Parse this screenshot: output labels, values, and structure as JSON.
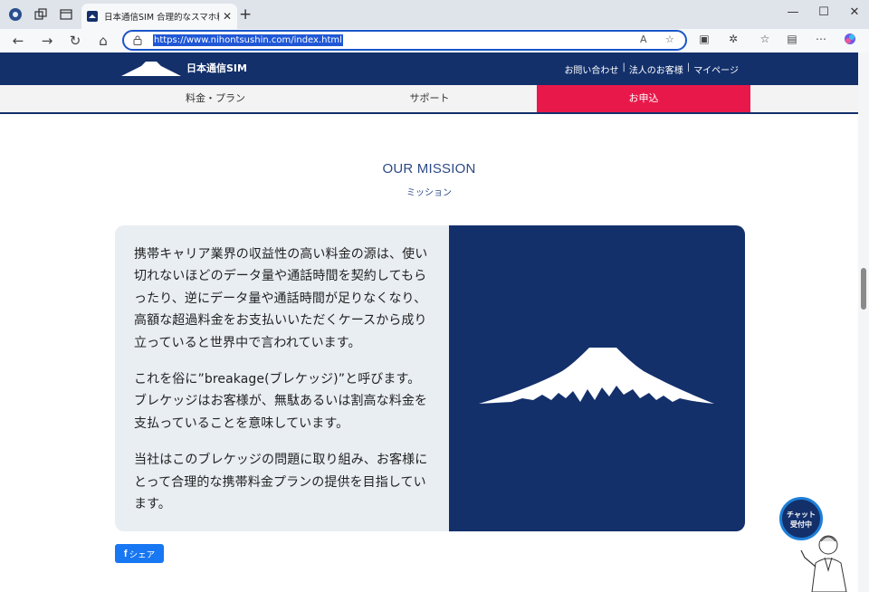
{
  "browser": {
    "tab_title": "日本通信SIM 合理的なスマホ料金",
    "url": "https://www.nihontsushin.com/index.html",
    "icons": [
      "browser-logo-icon",
      "workspaces-icon",
      "tab-actions-icon",
      "close-tab-icon",
      "new-tab-icon",
      "minimize-icon",
      "maximize-icon",
      "window-close-icon",
      "back-icon",
      "forward-icon",
      "refresh-icon",
      "home-icon",
      "lock-icon",
      "read-aloud-icon",
      "favorite-star-icon",
      "split-screen-icon",
      "extensions-icon",
      "favorites-icon",
      "collections-icon",
      "more-icon",
      "copilot-icon"
    ]
  },
  "header": {
    "brand": "日本通信SIM",
    "links": [
      "お問い合わせ",
      "法人のお客様",
      "マイページ"
    ],
    "separator": "|"
  },
  "gnav": {
    "items": [
      "料金・プラン",
      "サポート",
      "お申込"
    ]
  },
  "mission": {
    "title": "OUR MISSION",
    "subtitle": "ミッション",
    "paragraphs": [
      "携帯キャリア業界の収益性の高い料金の源は、使い切れないほどのデータ量や通話時間を契約してもらったり、逆にデータ量や通話時間が足りなくなり、高額な超過料金をお支払いいただくケースから成り立っていると世界中で言われています。",
      "これを俗に”breakage(ブレケッジ)”と呼びます。ブレケッジはお客様が、無駄あるいは割高な料金を支払っていることを意味しています。",
      "当社はこのブレケッジの問題に取り組み、お客様にとって合理的な携帯料金プランの提供を目指しています。"
    ]
  },
  "share": {
    "label": "シェア",
    "icon": "facebook-icon"
  },
  "chat": {
    "line1": "チャット",
    "line2": "受付中"
  },
  "colors": {
    "navy": "#13306b",
    "apply_red": "#e8194a",
    "card_bg": "#e9eef3",
    "facebook": "#1877f2"
  }
}
